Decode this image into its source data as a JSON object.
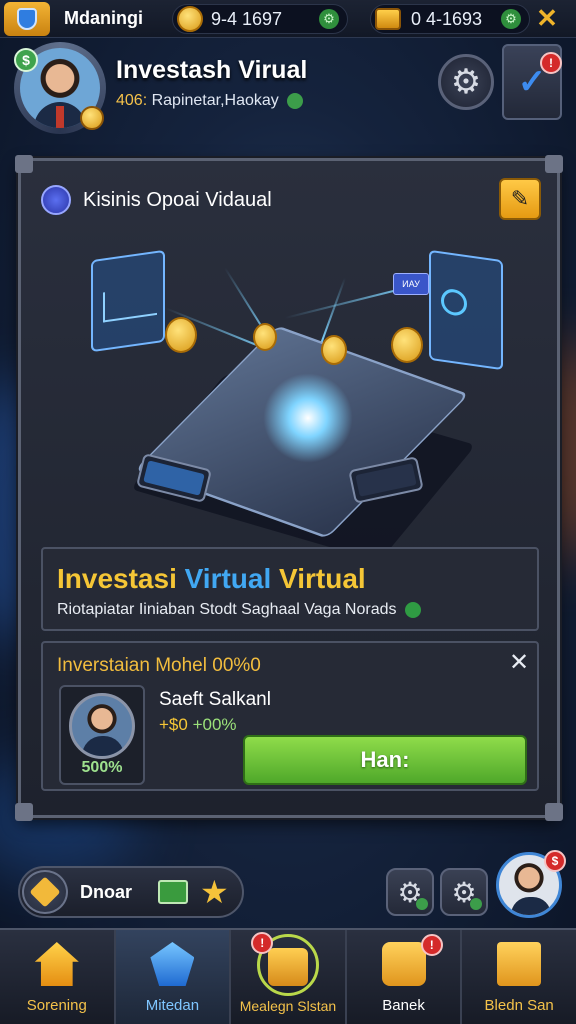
{
  "top_bar": {
    "player_name": "Mdaningi",
    "coins": "9-4 1697",
    "chests": "0 4-1693"
  },
  "header": {
    "title": "Investash Virual",
    "level": "406:",
    "subtitle": "Rapinetar,Haokay"
  },
  "panel": {
    "title": "Kisinis Opoai Vidaual",
    "illustration": {
      "tag_text": "ИАУ"
    },
    "info": {
      "title_part1": "Investasi ",
      "title_part2": "Virtual",
      "title_part3": " Virtual",
      "subtitle": "Riotapiatar Iiniaban Stodt Saghaal Vaga Norads"
    },
    "reward": {
      "title": "Inverstaian Mohel 00%0",
      "card_percent": "500%",
      "name": "Saeft Salkanl",
      "gain_prefix": "+$0 ",
      "gain_percent": "+00%",
      "button_label": "Han:"
    }
  },
  "quick_bar": {
    "label": "Dnoar"
  },
  "notifications": {
    "check_badge": "!",
    "profile_badge": "$",
    "nav_center_badge": "!",
    "nav_banek_badge": "!"
  },
  "nav": {
    "items": [
      {
        "label": "Sorening",
        "icon": "house-icon",
        "color": "#f4c24a"
      },
      {
        "label": "Mitedan",
        "icon": "gem-icon",
        "color": "#7fc6ff"
      },
      {
        "label": "Mealegn Slstan",
        "icon": "crate-icon",
        "color": "#f4c24a"
      },
      {
        "label": "Banek",
        "icon": "gift-box-icon",
        "color": "#ffffff"
      },
      {
        "label": "Bledn San",
        "icon": "briefcase-icon",
        "color": "#f4c24a"
      }
    ]
  },
  "colors": {
    "accent_gold": "#f5c636",
    "accent_blue": "#41a8f3",
    "button_green": "#6cc23a"
  }
}
